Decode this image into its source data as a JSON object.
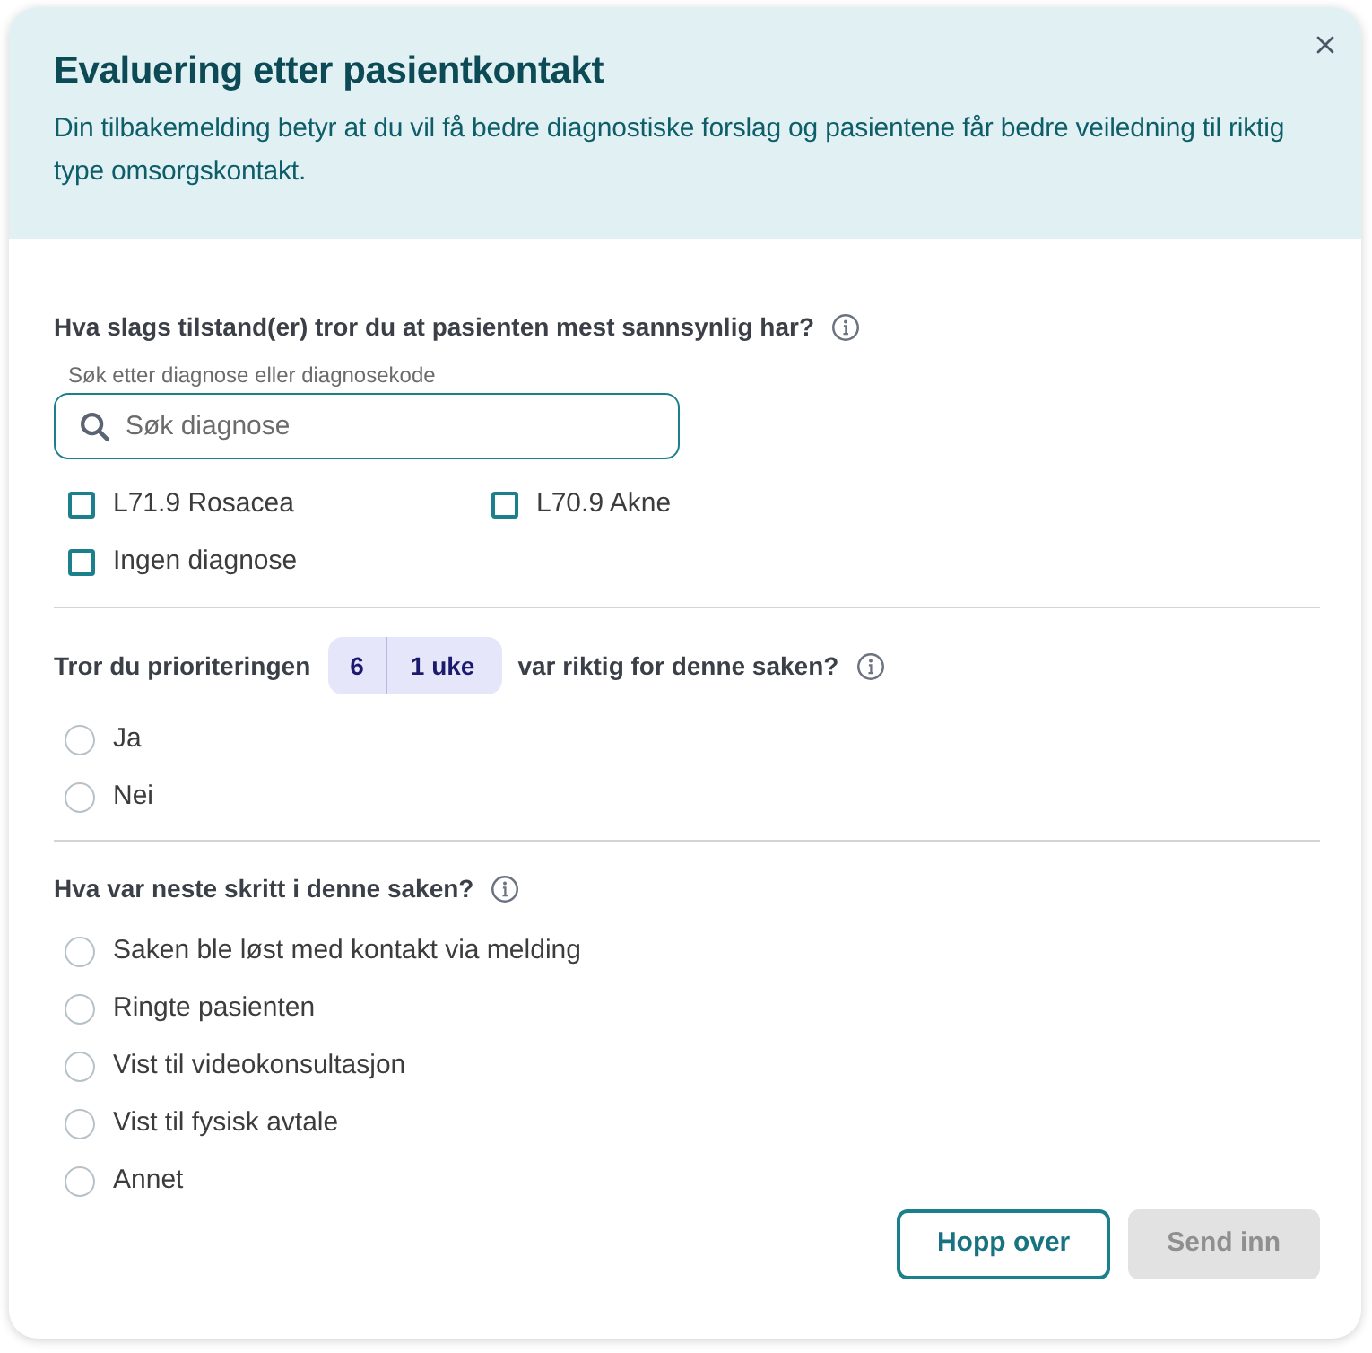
{
  "dialog": {
    "title": "Evaluering etter pasientkontakt",
    "description": "Din tilbakemelding betyr at du vil få bedre diagnostiske forslag og pasientene får bedre veiledning til riktig type omsorgskontakt."
  },
  "questions": [
    {
      "kind": "search",
      "label": "Hva slags tilstand(er) tror du at pasienten mest sannsynlig har?",
      "search": {
        "label": "Søk etter diagnose eller diagnosekode",
        "placeholder": "Søk diagnose"
      },
      "options": [
        {
          "label": "L71.9 Rosacea",
          "checked": false
        },
        {
          "label": "L70.9 Akne",
          "checked": false
        },
        {
          "label": "Ingen diagnose",
          "checked": false
        }
      ]
    },
    {
      "kind": "priority",
      "label_before": "Tror du prioriteringen",
      "priority": {
        "number": "6",
        "time": "1 uke"
      },
      "label_after": "var riktig for denne saken?",
      "options": [
        {
          "label": "Ja",
          "selected": false
        },
        {
          "label": "Nei",
          "selected": false
        }
      ]
    },
    {
      "kind": "radio",
      "label": "Hva var neste skritt i denne saken?",
      "options": [
        {
          "label": "Saken ble løst med kontakt via melding",
          "selected": false
        },
        {
          "label": "Ringte pasienten",
          "selected": false
        },
        {
          "label": "Vist til videokonsultasjon",
          "selected": false
        },
        {
          "label": "Vist til fysisk avtale",
          "selected": false
        },
        {
          "label": "Annet",
          "selected": false
        }
      ]
    }
  ],
  "buttons": [
    {
      "label": "Hopp over",
      "kind": "secondary",
      "disabled": false
    },
    {
      "label": "Send inn",
      "kind": "primary",
      "disabled": true
    }
  ]
}
